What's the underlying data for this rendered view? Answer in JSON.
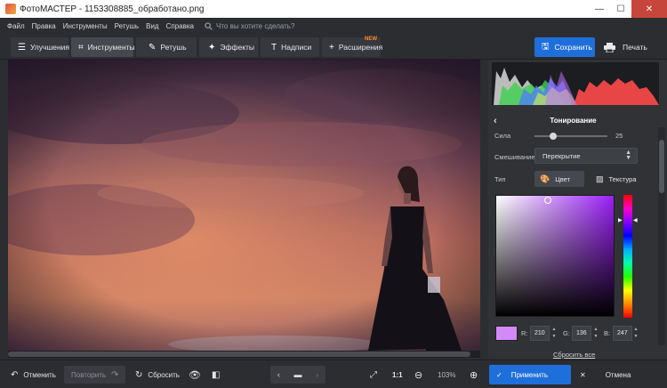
{
  "window": {
    "title": "ФотоМАСТЕР - 1153308885_обработано.png",
    "minimize": "—",
    "maximize": "☐",
    "close": "✕"
  },
  "menu": {
    "items": [
      "Файл",
      "Правка",
      "Инструменты",
      "Ретушь",
      "Вид",
      "Справка"
    ],
    "search_placeholder": "Что вы хотите сделать?"
  },
  "toolbar": {
    "tabs": [
      {
        "label": "Улучшения",
        "icon": "sliders-icon"
      },
      {
        "label": "Инструменты",
        "icon": "crop-icon"
      },
      {
        "label": "Ретушь",
        "icon": "brush-icon"
      },
      {
        "label": "Эффекты",
        "icon": "magic-icon"
      },
      {
        "label": "Надписи",
        "icon": "text-icon"
      },
      {
        "label": "Расширения",
        "icon": "plus-icon"
      }
    ],
    "new_badge": "NEW",
    "save_label": "Сохранить",
    "print_label": "Печать"
  },
  "panel": {
    "title": "Тонирование",
    "strength_label": "Сила",
    "strength_value": "25",
    "strength_level": 0.25,
    "blend_label": "Смешивание",
    "blend_value": "Перекрытие",
    "type_label": "Тип",
    "type_color": "Цвет",
    "type_texture": "Текстура",
    "color": {
      "hex": "#d28af7",
      "r_label": "R:",
      "r": "210",
      "g_label": "G:",
      "g": "136",
      "b_label": "B:",
      "b": "247"
    },
    "reset_all": "Сбросить все"
  },
  "bottom": {
    "undo": "Отменить",
    "redo": "Повторить",
    "reset": "Сбросить",
    "ratio": "1:1",
    "zoom": "103%",
    "apply": "Применить",
    "cancel": "Отмена"
  },
  "colors": {
    "accent": "#1f6fdb",
    "new_badge": "#ff8a2b"
  }
}
